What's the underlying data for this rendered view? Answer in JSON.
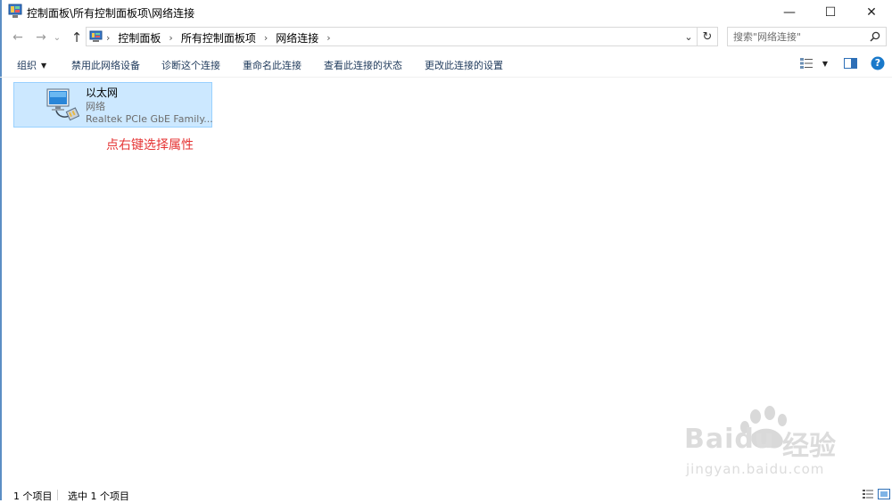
{
  "window": {
    "title": "控制面板\\所有控制面板项\\网络连接",
    "minimize_glyph": "—",
    "maximize_glyph": "☐",
    "close_glyph": "✕"
  },
  "nav": {
    "back_glyph": "←",
    "forward_glyph": "→",
    "recent_glyph": "⌄",
    "up_glyph": "↑"
  },
  "address": {
    "breadcrumbs": [
      "控制面板",
      "所有控制面板项",
      "网络连接"
    ],
    "separator": "›",
    "dropdown_glyph": "⌄",
    "refresh_glyph": "↻"
  },
  "search": {
    "placeholder": "搜索\"网络连接\"",
    "icon": "search-icon"
  },
  "toolbar": {
    "organize": "组织",
    "disable_device": "禁用此网络设备",
    "diagnose": "诊断这个连接",
    "rename": "重命名此连接",
    "view_status": "查看此连接的状态",
    "change_settings": "更改此连接的设置",
    "help_glyph": "?"
  },
  "connection": {
    "name": "以太网",
    "status": "网络",
    "device": "Realtek PCIe GbE Family..."
  },
  "annotation": "点右键选择属性",
  "statusbar": {
    "count": "1 个项目",
    "selected": "选中 1 个项目"
  },
  "watermark": {
    "brand": "Baidu",
    "jingyan": "经验",
    "url": "jingyan.baidu.com"
  },
  "colors": {
    "selection_bg": "#cce8ff",
    "selection_border": "#99d1ff",
    "annotation": "#e53333",
    "help_blue": "#1979ca"
  }
}
